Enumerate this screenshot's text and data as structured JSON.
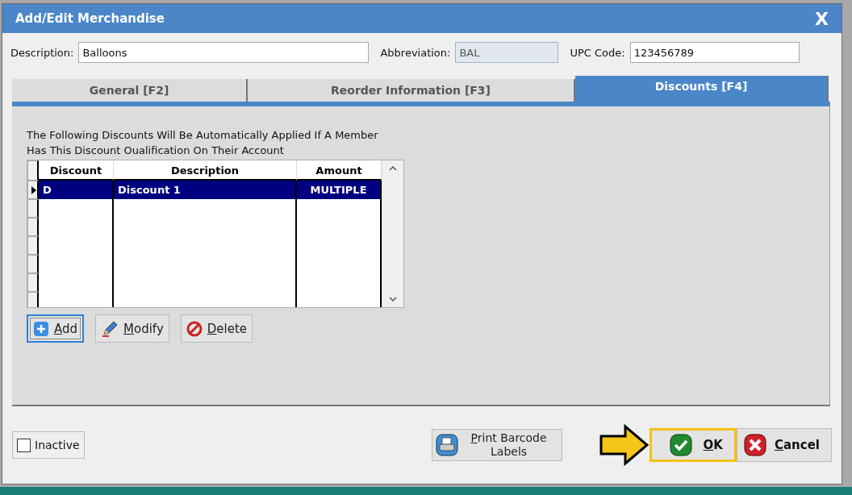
{
  "window": {
    "title": "Add/Edit Merchandise",
    "close": "X"
  },
  "fields": [
    {
      "label": "Description:",
      "value": "Balloons",
      "disabled": false
    },
    {
      "label": "Abbreviation:",
      "value": "BAL",
      "disabled": true
    },
    {
      "label": "UPC Code:",
      "value": "123456789",
      "disabled": false
    }
  ],
  "tabs": [
    {
      "label": "General [F2]",
      "selected": false
    },
    {
      "label": "Reorder Information [F3]",
      "selected": false
    },
    {
      "label": "Discounts [F4]",
      "selected": true
    }
  ],
  "intro": "The Following Discounts Will Be Automatically Applied If A Member Has This Discount Oualification On Their Account",
  "table": {
    "columns": [
      "Discount",
      "Description",
      "Amount"
    ],
    "rows": [
      {
        "cells": [
          "D",
          "Discount 1",
          "MULTIPLE"
        ],
        "selected": true
      }
    ]
  },
  "table_buttons": [
    {
      "label": "Add",
      "kind": "add",
      "focused": true
    },
    {
      "label": "Modify",
      "kind": "modify",
      "focused": false
    },
    {
      "label": "Delete",
      "kind": "delete",
      "focused": false
    }
  ],
  "inactive": {
    "label": "Inactive",
    "checked": false
  },
  "print_button": {
    "label": "Print Barcode Labels"
  },
  "ok_button": {
    "label": "OK",
    "highlighted": true
  },
  "cancel_button": {
    "label": "Cancel"
  }
}
